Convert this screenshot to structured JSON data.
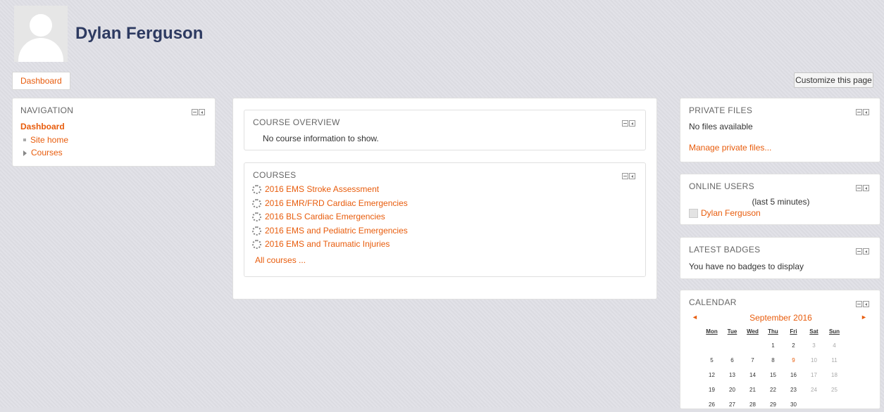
{
  "header": {
    "user_name": "Dylan Ferguson",
    "breadcrumb": "Dashboard",
    "customize_label": "Customize this page"
  },
  "navigation": {
    "title": "NAVIGATION",
    "current": "Dashboard",
    "items": [
      {
        "label": "Site home",
        "icon": "bullet-icon"
      },
      {
        "label": "Courses",
        "icon": "triangle-right-icon"
      }
    ]
  },
  "course_overview": {
    "title": "COURSE OVERVIEW",
    "message": "No course information to show."
  },
  "courses": {
    "title": "COURSES",
    "items": [
      "2016 EMS Stroke Assessment",
      "2016 EMR/FRD Cardiac Emergencies",
      "2016 BLS Cardiac Emergencies",
      "2016 EMS and Pediatric Emergencies",
      "2016 EMS and Traumatic Injuries"
    ],
    "all_link": "All courses ..."
  },
  "private_files": {
    "title": "PRIVATE FILES",
    "message": "No files available",
    "manage_link": "Manage private files..."
  },
  "online_users": {
    "title": "ONLINE USERS",
    "period": "(last 5 minutes)",
    "user": "Dylan Ferguson"
  },
  "latest_badges": {
    "title": "LATEST BADGES",
    "message": "You have no badges to display"
  },
  "calendar": {
    "title": "CALENDAR",
    "month": "September 2016",
    "prev": "◄",
    "next": "►",
    "days": [
      "Mon",
      "Tue",
      "Wed",
      "Thu",
      "Fri",
      "Sat",
      "Sun"
    ],
    "weeks": [
      [
        "",
        "",
        "",
        "1",
        "2",
        "3",
        "4"
      ],
      [
        "5",
        "6",
        "7",
        "8",
        "9",
        "10",
        "11"
      ],
      [
        "12",
        "13",
        "14",
        "15",
        "16",
        "17",
        "18"
      ],
      [
        "19",
        "20",
        "21",
        "22",
        "23",
        "24",
        "25"
      ],
      [
        "26",
        "27",
        "28",
        "29",
        "30",
        "",
        ""
      ]
    ],
    "today": "9"
  },
  "colors": {
    "accent": "#e85c0c",
    "title": "#2d3a61"
  }
}
